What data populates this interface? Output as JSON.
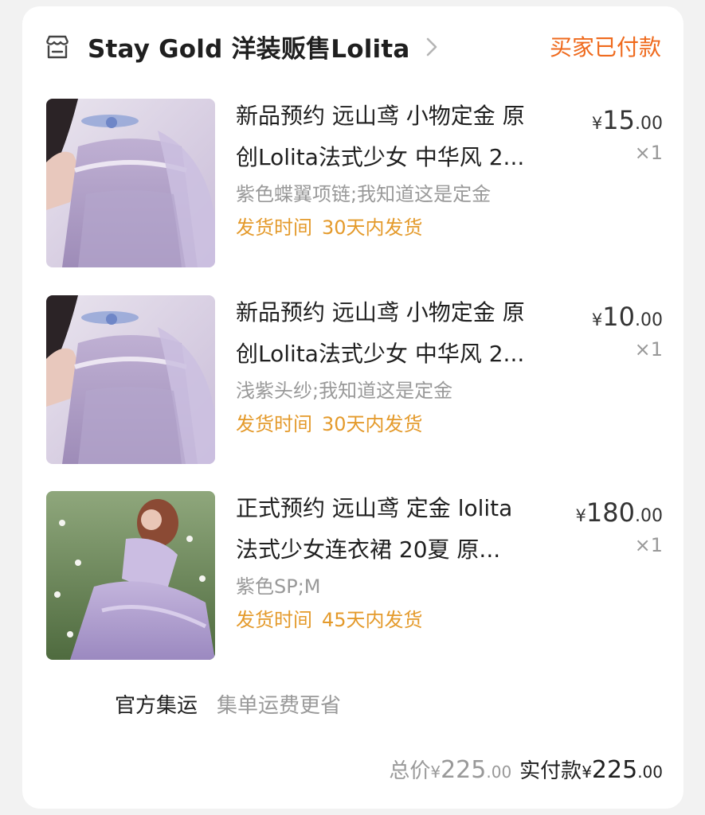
{
  "shop": {
    "icon": "shop-icon",
    "name": "Stay Gold 洋装贩售Lolita",
    "status": "买家已付款"
  },
  "items": [
    {
      "image": "product-photo-choker-dress",
      "title_line1": "新品预约 远山鸢 小物定金 原",
      "title_line2": "创Lolita法式少女 中华风 2...",
      "sku": "紫色蝶翼项链;我知道这是定金",
      "ship_label": "发货时间",
      "ship_value": "30天内发货",
      "price_currency": "¥",
      "price_int": "15",
      "price_dec": ".00",
      "qty": "×1"
    },
    {
      "image": "product-photo-choker-dress",
      "title_line1": "新品预约 远山鸢 小物定金 原",
      "title_line2": "创Lolita法式少女 中华风 2...",
      "sku": "浅紫头纱;我知道这是定金",
      "ship_label": "发货时间",
      "ship_value": "30天内发货",
      "price_currency": "¥",
      "price_int": "10",
      "price_dec": ".00",
      "qty": "×1"
    },
    {
      "image": "product-photo-flower-field-dress",
      "title_line1": "正式预约 远山鸢 定金 lolita",
      "title_line2": "法式少女连衣裙 20夏 原...",
      "sku": "紫色SP;M",
      "ship_label": "发货时间",
      "ship_value": "45天内发货",
      "price_currency": "¥",
      "price_int": "180",
      "price_dec": ".00",
      "qty": "×1"
    }
  ],
  "consolidation": {
    "label": "官方集运",
    "description": "集单运费更省"
  },
  "summary": {
    "total_label": "总价",
    "total_currency": "¥",
    "total_int": "225",
    "total_dec": ".00",
    "paid_label": "实付款",
    "paid_currency": "¥",
    "paid_int": "225",
    "paid_dec": ".00"
  },
  "colors": {
    "status": "#ef6a1d",
    "shipping": "#e49a2b",
    "muted": "#999999",
    "text": "#1f1f1f"
  }
}
